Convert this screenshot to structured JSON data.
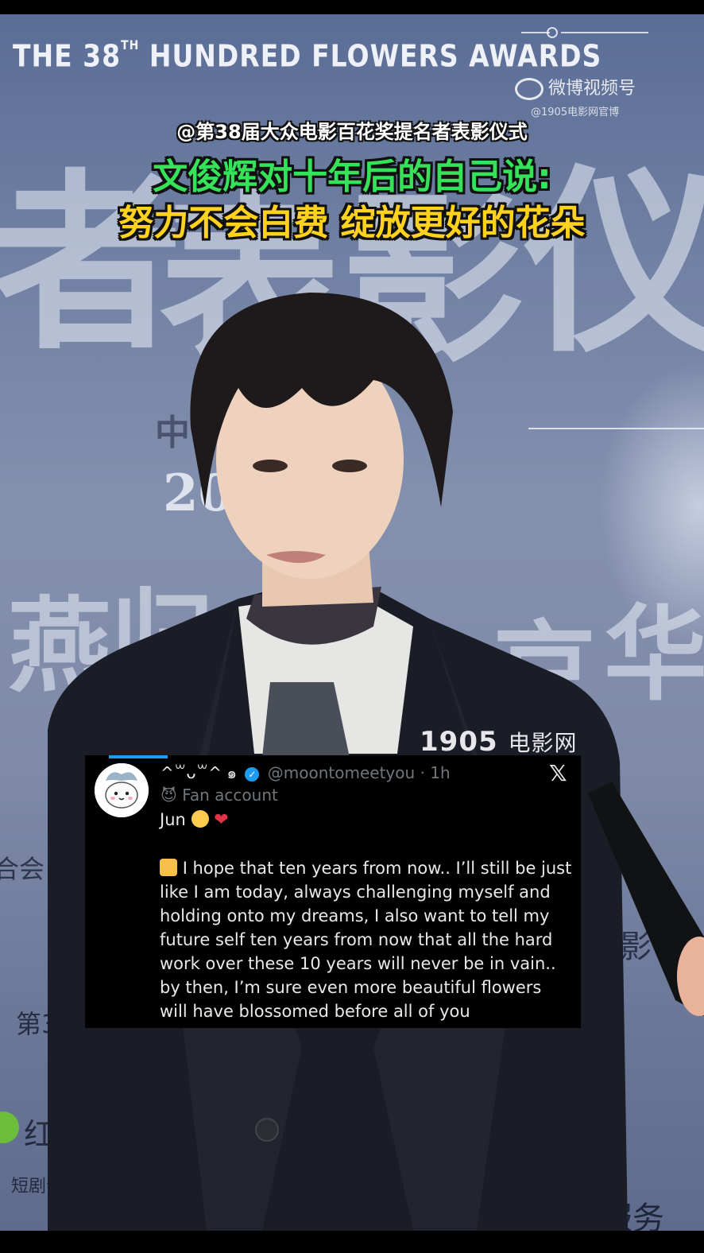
{
  "video": {
    "awards_text_prefix": "THE 38",
    "awards_text_sup": "TH",
    "awards_text_suffix": " HUNDRED FLOWERS AWARDS",
    "weibo_logo": "微博视频号",
    "weibo_sub": "@1905电影网官博",
    "caption_line1": "@第38届大众电影百花奖提名者表影仪式",
    "caption_line2": "文俊辉对十年后的自己说:",
    "caption_line3": "努力不会白费 绽放更好的花朵",
    "watermark_num": "1905",
    "watermark_cn": "电影网",
    "bg_chars": {
      "big1": "者",
      "big2": "表",
      "big3": "影",
      "big4": "仪",
      "mid1": "燕",
      "mid2": "归",
      "mid3": "京",
      "mid4": "华",
      "small_zhong": "中",
      "small_20": "20",
      "left_he": "合会",
      "left_38": "第38届",
      "left_hongguo": "红果短",
      "left_duanju": "短剧合作平台",
      "right_ying": "影",
      "bottom_right": "音生活服务"
    },
    "colors": {
      "caption_green": "#35e25a",
      "caption_yellow": "#ffd21e"
    }
  },
  "tweet": {
    "display_name": "^꒳ᴗ꒳^ ๑",
    "handle": "@moontomeetyou",
    "separator": "·",
    "time": "1h",
    "label_icon": "mask-icon",
    "label": "Fan account",
    "line1": "Jun",
    "quote": "I hope that ten years from now.. I’ll still be just like I am today, always challenging myself and holding onto my dreams, I also want to tell my future self ten years from now that all the hard work over these 10 years will never be in vain.. by then, I’m sure even more beautiful flowers will have blossomed before all of you",
    "x_logo": "𝕏",
    "accent": "#1d9bf0"
  }
}
